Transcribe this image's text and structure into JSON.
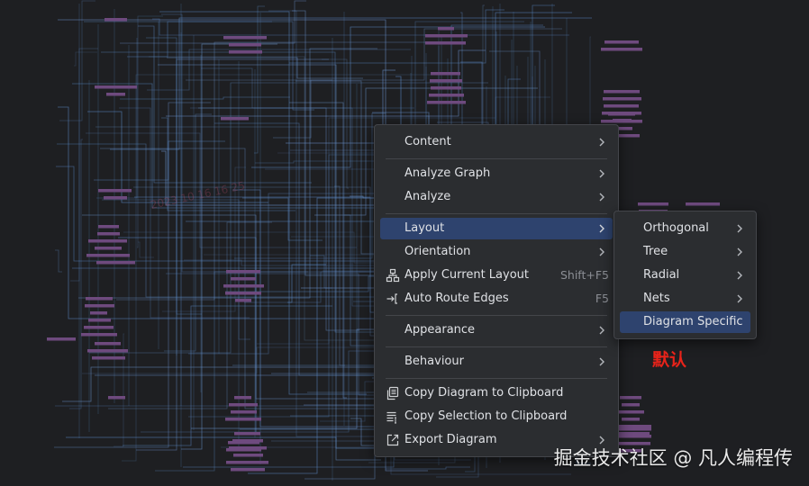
{
  "main_menu": {
    "items": [
      {
        "label": "Content",
        "has_submenu": true
      },
      {
        "label": "Analyze Graph",
        "has_submenu": true
      },
      {
        "label": "Analyze",
        "has_submenu": true
      },
      {
        "label": "Layout",
        "has_submenu": true,
        "selected": true
      },
      {
        "label": "Orientation",
        "has_submenu": true
      },
      {
        "label": "Apply Current Layout",
        "shortcut": "Shift+F5",
        "icon": "hierarchy-layout-icon"
      },
      {
        "label": "Auto Route Edges",
        "shortcut": "F5",
        "icon": "route-edges-icon"
      },
      {
        "label": "Appearance",
        "has_submenu": true
      },
      {
        "label": "Behaviour",
        "has_submenu": true
      },
      {
        "label": "Copy Diagram to Clipboard",
        "icon": "copy-icon"
      },
      {
        "label": "Copy Selection to Clipboard",
        "icon": "copy-selection-icon"
      },
      {
        "label": "Export Diagram",
        "has_submenu": true,
        "icon": "export-icon"
      }
    ]
  },
  "layout_submenu": {
    "items": [
      {
        "label": "Orthogonal",
        "has_submenu": true
      },
      {
        "label": "Tree",
        "has_submenu": true
      },
      {
        "label": "Radial",
        "has_submenu": true
      },
      {
        "label": "Nets",
        "has_submenu": true
      },
      {
        "label": "Diagram Specific",
        "selected": true
      }
    ]
  },
  "annotation": {
    "text": "默认",
    "color": "#e8231a"
  },
  "watermark": {
    "text": "掘金技术社区 @ 凡人编程传"
  },
  "colors": {
    "background": "#1e1f22",
    "menu_background": "#2b2d30",
    "selection": "#2e436e",
    "edge_lines": "#5a88c4",
    "node_fill": "#6e4a7e"
  }
}
